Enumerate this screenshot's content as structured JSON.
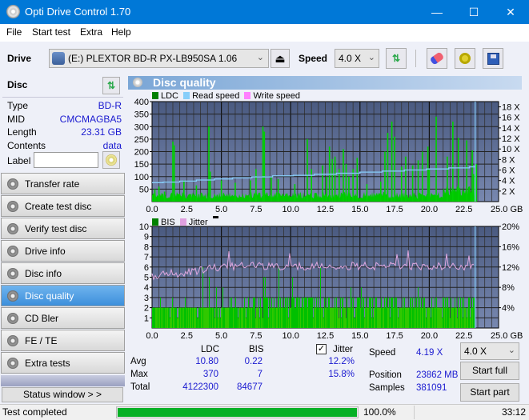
{
  "window": {
    "title": "Opti Drive Control 1.70",
    "minimize": "—",
    "maximize": "☐",
    "close": "✕"
  },
  "menu": [
    "File",
    "Start test",
    "Extra",
    "Help"
  ],
  "toolbar": {
    "drive_label": "Drive",
    "drive_value": "(E:)  PLEXTOR BD-R  PX-LB950SA 1.06",
    "speed_label": "Speed",
    "speed_value": "4.0 X"
  },
  "disc": {
    "header": "Disc",
    "rows": [
      {
        "k": "Type",
        "v": "BD-R"
      },
      {
        "k": "MID",
        "v": "CMCMAGBA5"
      },
      {
        "k": "Length",
        "v": "23.31 GB"
      },
      {
        "k": "Contents",
        "v": "data"
      }
    ],
    "label_label": "Label",
    "label_value": ""
  },
  "nav": [
    {
      "label": "Transfer rate",
      "active": false
    },
    {
      "label": "Create test disc",
      "active": false
    },
    {
      "label": "Verify test disc",
      "active": false
    },
    {
      "label": "Drive info",
      "active": false
    },
    {
      "label": "Disc info",
      "active": false
    },
    {
      "label": "Disc quality",
      "active": true
    },
    {
      "label": "CD Bler",
      "active": false
    },
    {
      "label": "FE / TE",
      "active": false
    },
    {
      "label": "Extra tests",
      "active": false
    }
  ],
  "status_window_btn": "Status window > >",
  "panel": {
    "title": "Disc quality"
  },
  "chart_data": [
    {
      "type": "bar",
      "title": "LDC",
      "legend": [
        "LDC",
        "Read speed",
        "Write speed"
      ],
      "legend_colors": [
        "#008000",
        "#87cefa",
        "#ff80ff"
      ],
      "x_ticks": [
        "0.0",
        "2.5",
        "5.0",
        "7.5",
        "10.0",
        "12.5",
        "15.0",
        "17.5",
        "20.0",
        "22.5",
        "25.0 GB"
      ],
      "xlim": [
        0,
        25
      ],
      "y_ticks": [
        "50",
        "100",
        "150",
        "200",
        "250",
        "300",
        "350",
        "400"
      ],
      "ylim": [
        0,
        400
      ],
      "y2_ticks": [
        "2 X",
        "4 X",
        "6 X",
        "8 X",
        "10 X",
        "12 X",
        "14 X",
        "16 X",
        "18 X"
      ],
      "y2lim": [
        0,
        19
      ],
      "ldc_peaks": [
        [
          0.2,
          50
        ],
        [
          0.5,
          60
        ],
        [
          0.9,
          40
        ],
        [
          1.5,
          240
        ],
        [
          1.6,
          225
        ],
        [
          2.3,
          85
        ],
        [
          2.8,
          30
        ],
        [
          3.2,
          65
        ],
        [
          4.1,
          300
        ],
        [
          4.2,
          120
        ],
        [
          5.0,
          85
        ],
        [
          6.0,
          75
        ],
        [
          7.1,
          85
        ],
        [
          7.5,
          130
        ],
        [
          8.0,
          300
        ],
        [
          8.1,
          280
        ],
        [
          8.6,
          100
        ],
        [
          9.1,
          90
        ],
        [
          10.3,
          70
        ],
        [
          11.2,
          250
        ],
        [
          11.5,
          130
        ],
        [
          12.3,
          145
        ],
        [
          12.6,
          100
        ],
        [
          12.8,
          220
        ],
        [
          13.0,
          170
        ],
        [
          13.2,
          180
        ],
        [
          13.5,
          130
        ],
        [
          13.8,
          210
        ],
        [
          14.0,
          150
        ],
        [
          14.2,
          100
        ],
        [
          14.5,
          130
        ],
        [
          14.8,
          175
        ],
        [
          15.5,
          70
        ],
        [
          16.5,
          80
        ],
        [
          16.8,
          200
        ],
        [
          17.0,
          275
        ],
        [
          17.3,
          320
        ],
        [
          17.5,
          260
        ],
        [
          18.0,
          140
        ],
        [
          18.3,
          180
        ],
        [
          18.8,
          145
        ],
        [
          19.2,
          165
        ],
        [
          19.5,
          200
        ],
        [
          19.9,
          220
        ],
        [
          20.0,
          130
        ],
        [
          20.5,
          340
        ],
        [
          21.3,
          180
        ],
        [
          21.7,
          320
        ],
        [
          22.1,
          255
        ],
        [
          22.7,
          245
        ],
        [
          23.1,
          205
        ],
        [
          23.2,
          110
        ],
        [
          23.4,
          150
        ]
      ],
      "ldc_base": 30,
      "read_speed": [
        [
          0,
          3.6
        ],
        [
          0.8,
          3.7
        ],
        [
          2.0,
          3.9
        ],
        [
          3.2,
          4.1
        ],
        [
          4.5,
          4.3
        ],
        [
          5.8,
          4.5
        ],
        [
          7.2,
          4.7
        ],
        [
          8.7,
          4.9
        ],
        [
          10.2,
          5.0
        ],
        [
          11.7,
          5.2
        ],
        [
          13.3,
          5.4
        ],
        [
          15.0,
          5.6
        ],
        [
          16.6,
          5.8
        ],
        [
          18.2,
          6.0
        ],
        [
          19.8,
          6.2
        ],
        [
          21.4,
          6.4
        ],
        [
          22.9,
          6.6
        ],
        [
          23.3,
          6.7
        ]
      ],
      "end_marker": 23.31
    },
    {
      "type": "bar",
      "title": "BIS",
      "legend": [
        "BIS",
        "Jitter"
      ],
      "legend_colors": [
        "#008000",
        "#e0a0e0"
      ],
      "x_ticks": [
        "0.0",
        "2.5",
        "5.0",
        "7.5",
        "10.0",
        "12.5",
        "15.0",
        "17.5",
        "20.0",
        "22.5",
        "25.0 GB"
      ],
      "xlim": [
        0,
        25
      ],
      "y_ticks": [
        "1",
        "2",
        "3",
        "4",
        "5",
        "6",
        "7",
        "8",
        "9",
        "10"
      ],
      "ylim": [
        0,
        10
      ],
      "y2_ticks": [
        "4%",
        "8%",
        "12%",
        "16%",
        "20%"
      ],
      "y2lim": [
        0,
        20
      ],
      "jitter_avg_pct": 12.2,
      "jitter_max_pct": 15.8,
      "jitter_start_pct": 10.2,
      "bis_base": 2,
      "bis_max": 7,
      "end_marker": 23.31
    }
  ],
  "stats": {
    "col_ldc": "LDC",
    "col_bis": "BIS",
    "jitter_label": "Jitter",
    "jitter_checked": true,
    "rows": [
      {
        "k": "Avg",
        "ldc": "10.80",
        "bis": "0.22",
        "jit": "12.2%"
      },
      {
        "k": "Max",
        "ldc": "370",
        "bis": "7",
        "jit": "15.8%"
      },
      {
        "k": "Total",
        "ldc": "4122300",
        "bis": "84677",
        "jit": ""
      }
    ]
  },
  "info": {
    "speed_label": "Speed",
    "speed_value": "4.19 X",
    "position_label": "Position",
    "position_value": "23862 MB",
    "samples_label": "Samples",
    "samples_value": "381091",
    "speed_select": "4.0 X",
    "start_full": "Start full",
    "start_part": "Start part"
  },
  "status": {
    "text": "Test completed",
    "progress_pct": 100,
    "progress_label": "100.0%",
    "time": "33:12",
    "progress_color": "#06b025"
  }
}
